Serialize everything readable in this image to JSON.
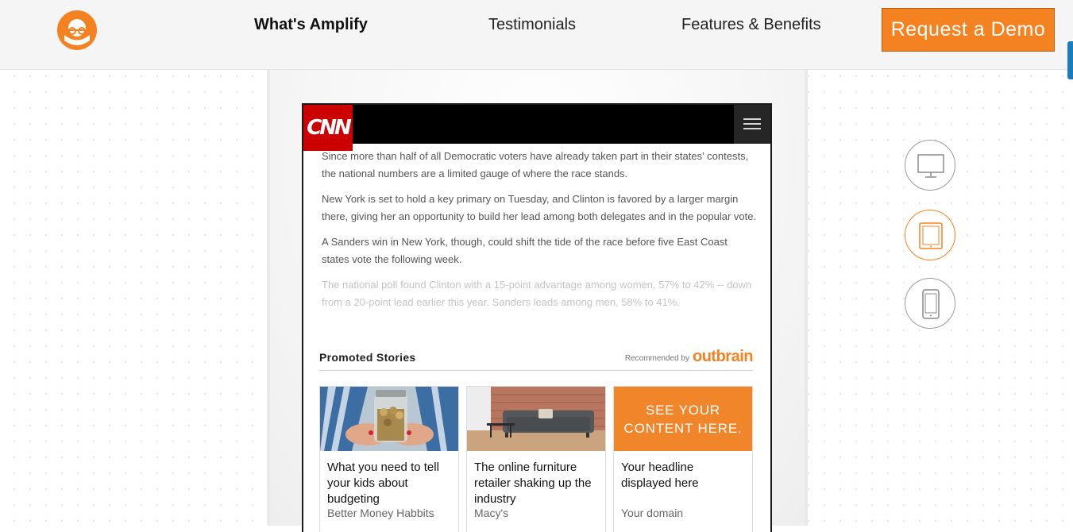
{
  "header": {
    "logo_icon": "outbrain-glasses-icon",
    "nav": [
      {
        "label": "What's Amplify",
        "active": true
      },
      {
        "label": "Testimonials",
        "active": false
      },
      {
        "label": "Features & Benefits",
        "active": false
      }
    ],
    "cta_label": "Request a Demo"
  },
  "preview": {
    "site_logo": "CNN",
    "menu_icon": "hamburger-icon",
    "paragraphs": [
      "Since more than half of all Democratic voters have already taken part in their states' contests, the national numbers are a limited gauge of where the race stands.",
      "New York is set to hold a key primary on Tuesday, and Clinton is favored by a larger margin there, giving her an opportunity to build her lead among both delegates and in the popular vote.",
      "A Sanders win in New York, though, could shift the tide of the race before five East Coast states vote the following week.",
      "The national poll found Clinton with a 15-point advantage among women, 57% to 42% -- down from a 20-point lead earlier this year. Sanders leads among men, 58% to 41%."
    ],
    "promoted": {
      "heading": "Promoted Stories",
      "recommended_by": "Recommended by",
      "brand": "outbrain",
      "cards": [
        {
          "title": "What you need to tell your kids about budgeting",
          "source": "Better Money Habbits",
          "image": "coin-jar"
        },
        {
          "title": "The online furniture retailer shaking up the industry",
          "source": "Macy's",
          "image": "sofa"
        },
        {
          "title": "Your headline displayed here",
          "source": "Your domain",
          "image_text": "SEE YOUR CONTENT HERE."
        }
      ]
    }
  },
  "device_selector": [
    {
      "icon": "desktop-icon",
      "selected": false
    },
    {
      "icon": "tablet-icon",
      "selected": true
    },
    {
      "icon": "mobile-icon",
      "selected": false
    }
  ],
  "colors": {
    "brand_orange": "#f58220",
    "cnn_red": "#cc0000",
    "header_bg": "#f5f5f5"
  }
}
